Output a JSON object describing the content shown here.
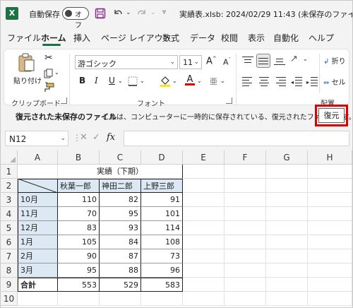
{
  "titlebar": {
    "app_icon": "X",
    "autosave_label": "自動保存",
    "autosave_state": "オフ",
    "doc_title": "実績表.xlsb: 2024/02/29 11:43 (未保存のファイル) ·"
  },
  "tabs": [
    "ファイル",
    "ホーム",
    "挿入",
    "ページ レイアウト",
    "数式",
    "データ",
    "校閲",
    "表示",
    "自動化",
    "ヘルプ"
  ],
  "active_tab": "ホーム",
  "ribbon": {
    "paste_label": "貼り付け",
    "clipboard_label": "クリップボード",
    "font_name": "游ゴシック",
    "font_size": "11",
    "font_group_label": "フォント",
    "align_group_label": "配置",
    "wrap_label": "折り",
    "merge_label": "セル",
    "bold": "B",
    "italic": "I",
    "underline": "U",
    "grow_font": "A",
    "shrink_font": "A",
    "font_color_glyph": "A",
    "ruby_glyph": "亜",
    "highlight_color": "#ffe600",
    "font_color": "#e00000"
  },
  "infobar": {
    "title": "復元された未保存のファイル",
    "message": "これは、コンピューターに一時的に保存されている、復元されたファイルです。",
    "restore_button": "復元"
  },
  "formula_bar": {
    "name_box": "N12",
    "fx": "fx",
    "value": ""
  },
  "grid": {
    "columns": [
      "A",
      "B",
      "C",
      "D",
      "E",
      "F",
      "G",
      "H"
    ],
    "rows": [
      "1",
      "2",
      "3",
      "4",
      "5",
      "6",
      "7",
      "8",
      "9",
      "10"
    ],
    "title": "実績（下期）",
    "headers": [
      "秋葉一郎",
      "神田二郎",
      "上野三郎"
    ],
    "data": [
      {
        "month": "10月",
        "values": [
          "110",
          "82",
          "91"
        ]
      },
      {
        "month": "11月",
        "values": [
          "70",
          "95",
          "101"
        ]
      },
      {
        "month": "12月",
        "values": [
          "83",
          "93",
          "114"
        ]
      },
      {
        "month": "1月",
        "values": [
          "105",
          "84",
          "108"
        ]
      },
      {
        "month": "2月",
        "values": [
          "90",
          "87",
          "73"
        ]
      },
      {
        "month": "3月",
        "values": [
          "95",
          "88",
          "96"
        ]
      }
    ],
    "total_label": "合計",
    "totals": [
      "553",
      "529",
      "583"
    ]
  },
  "colors": {
    "accent": "#1e7145",
    "header_fill": "#dce9f4",
    "highlight_border": "#e00000"
  }
}
